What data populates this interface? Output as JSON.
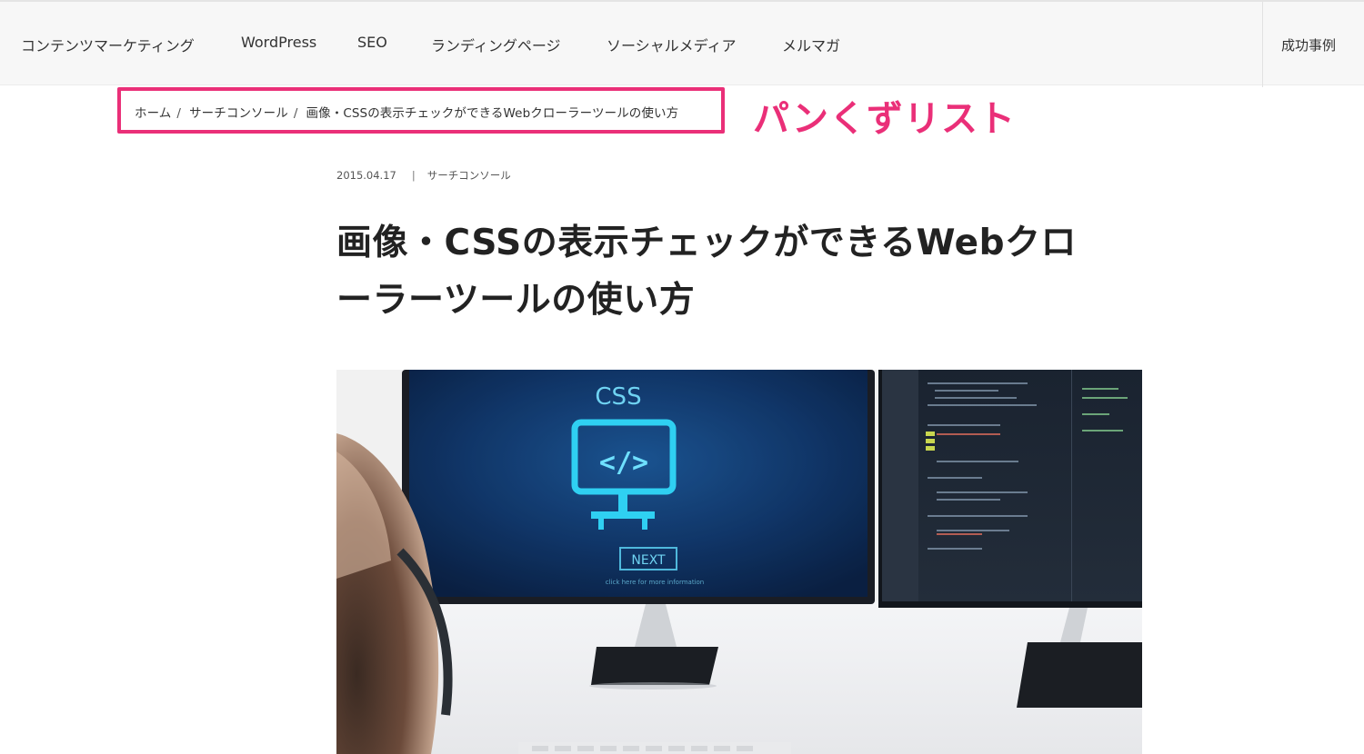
{
  "nav": {
    "items": [
      {
        "label": "コンテンツマーケティング"
      },
      {
        "label": "WordPress"
      },
      {
        "label": "SEO"
      },
      {
        "label": "ランディングページ"
      },
      {
        "label": "ソーシャルメディア"
      },
      {
        "label": "メルマガ"
      }
    ],
    "right_label": "成功事例"
  },
  "breadcrumb": {
    "items": [
      {
        "label": "ホーム"
      },
      {
        "label": "サーチコンソール"
      },
      {
        "label": "画像・CSSの表示チェックができるWebクローラーツールの使い方"
      }
    ],
    "separator": "/"
  },
  "annotation": {
    "label": "パンくずリスト",
    "color": "#ea2f78"
  },
  "post": {
    "date": "2015.04.17",
    "meta_separator": "|",
    "category": "サーチコンソール",
    "title_line1": "画像・CSSの表示チェックができるWebクロ",
    "title_line2": "ーラーツールの使い方"
  },
  "hero": {
    "screen_heading": "CSS",
    "screen_code_glyph": "</>",
    "screen_button": "NEXT",
    "screen_caption": "click here for more information",
    "accent": "#27c3e8"
  }
}
